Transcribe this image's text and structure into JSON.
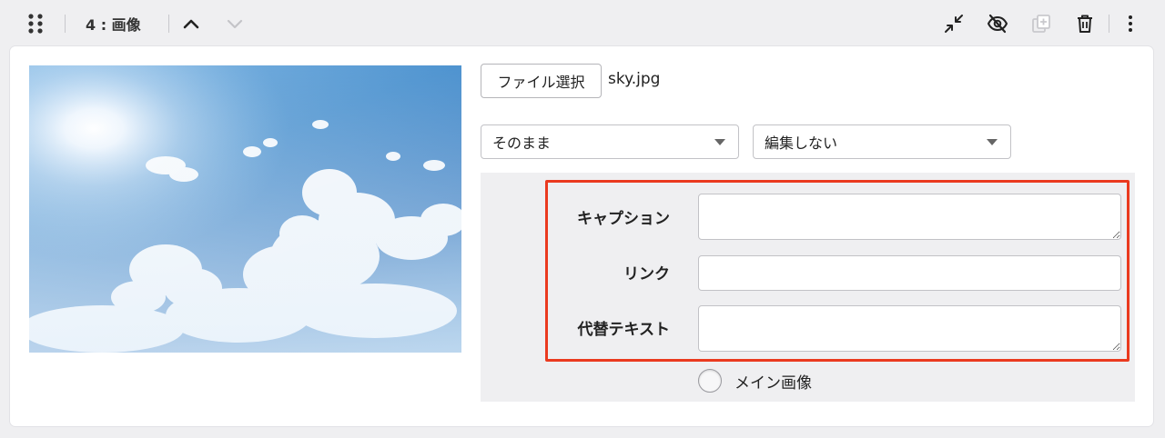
{
  "block": {
    "title": "4 : 画像"
  },
  "toolbar": {
    "icons": {
      "drag": "drag-handle-icon",
      "up": "chevron-up-icon",
      "down": "chevron-down-icon",
      "collapse": "collapse-icon",
      "hide": "eye-off-icon",
      "duplicate": "duplicate-icon",
      "delete": "trash-icon",
      "more": "more-vertical-icon"
    }
  },
  "image": {
    "file_button_label": "ファイル選択",
    "file_name": "sky.jpg"
  },
  "selects": {
    "size": {
      "selected": "そのまま"
    },
    "edit": {
      "selected": "編集しない"
    }
  },
  "fields": {
    "caption": {
      "label": "キャプション",
      "value": ""
    },
    "link": {
      "label": "リンク",
      "value": ""
    },
    "alt": {
      "label": "代替テキスト",
      "value": ""
    }
  },
  "main_image": {
    "label": "メイン画像",
    "checked": false
  },
  "colors": {
    "highlight": "#ea3a1f",
    "panel_background": "#efeff1",
    "card_background": "#ffffff"
  }
}
